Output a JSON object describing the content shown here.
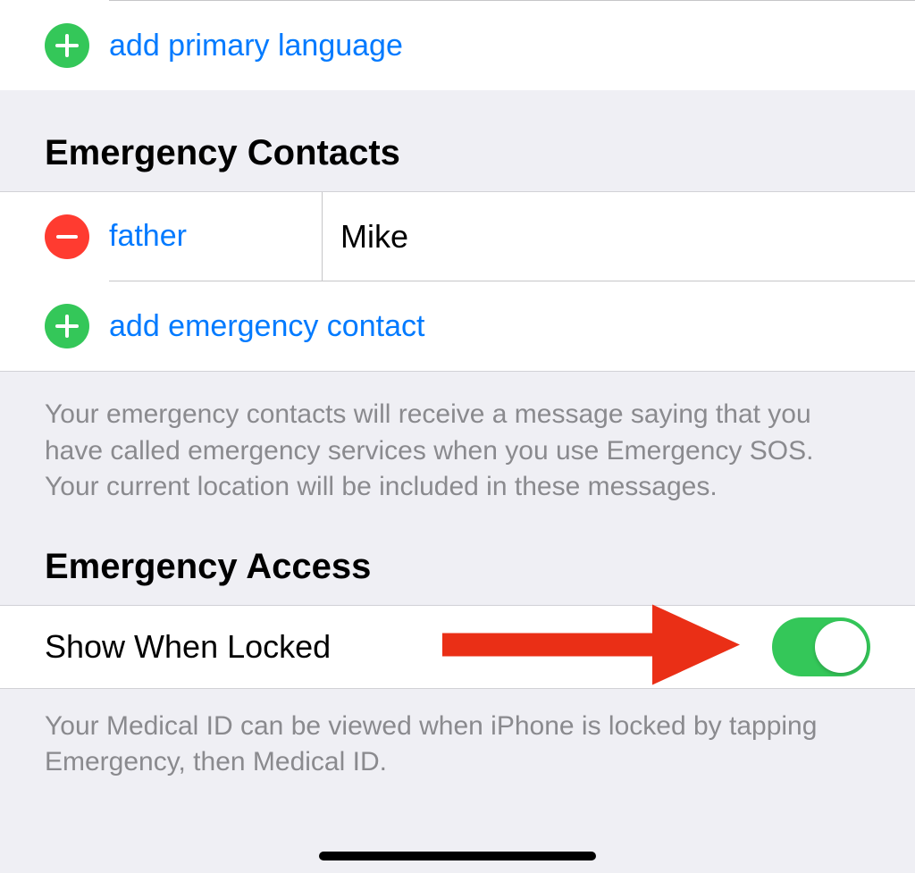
{
  "language": {
    "add_label": "add primary language"
  },
  "emergency_contacts": {
    "header": "Emergency Contacts",
    "items": [
      {
        "relation": "father",
        "name": "Mike"
      }
    ],
    "add_label": "add emergency contact",
    "footer": "Your emergency contacts will receive a message saying that you have called emergency services when you use Emergency SOS. Your current location will be included in these messages."
  },
  "emergency_access": {
    "header": "Emergency Access",
    "show_when_locked_label": "Show When Locked",
    "show_when_locked_on": true,
    "footer": "Your Medical ID can be viewed when iPhone is locked by tapping Emergency, then Medical ID."
  }
}
